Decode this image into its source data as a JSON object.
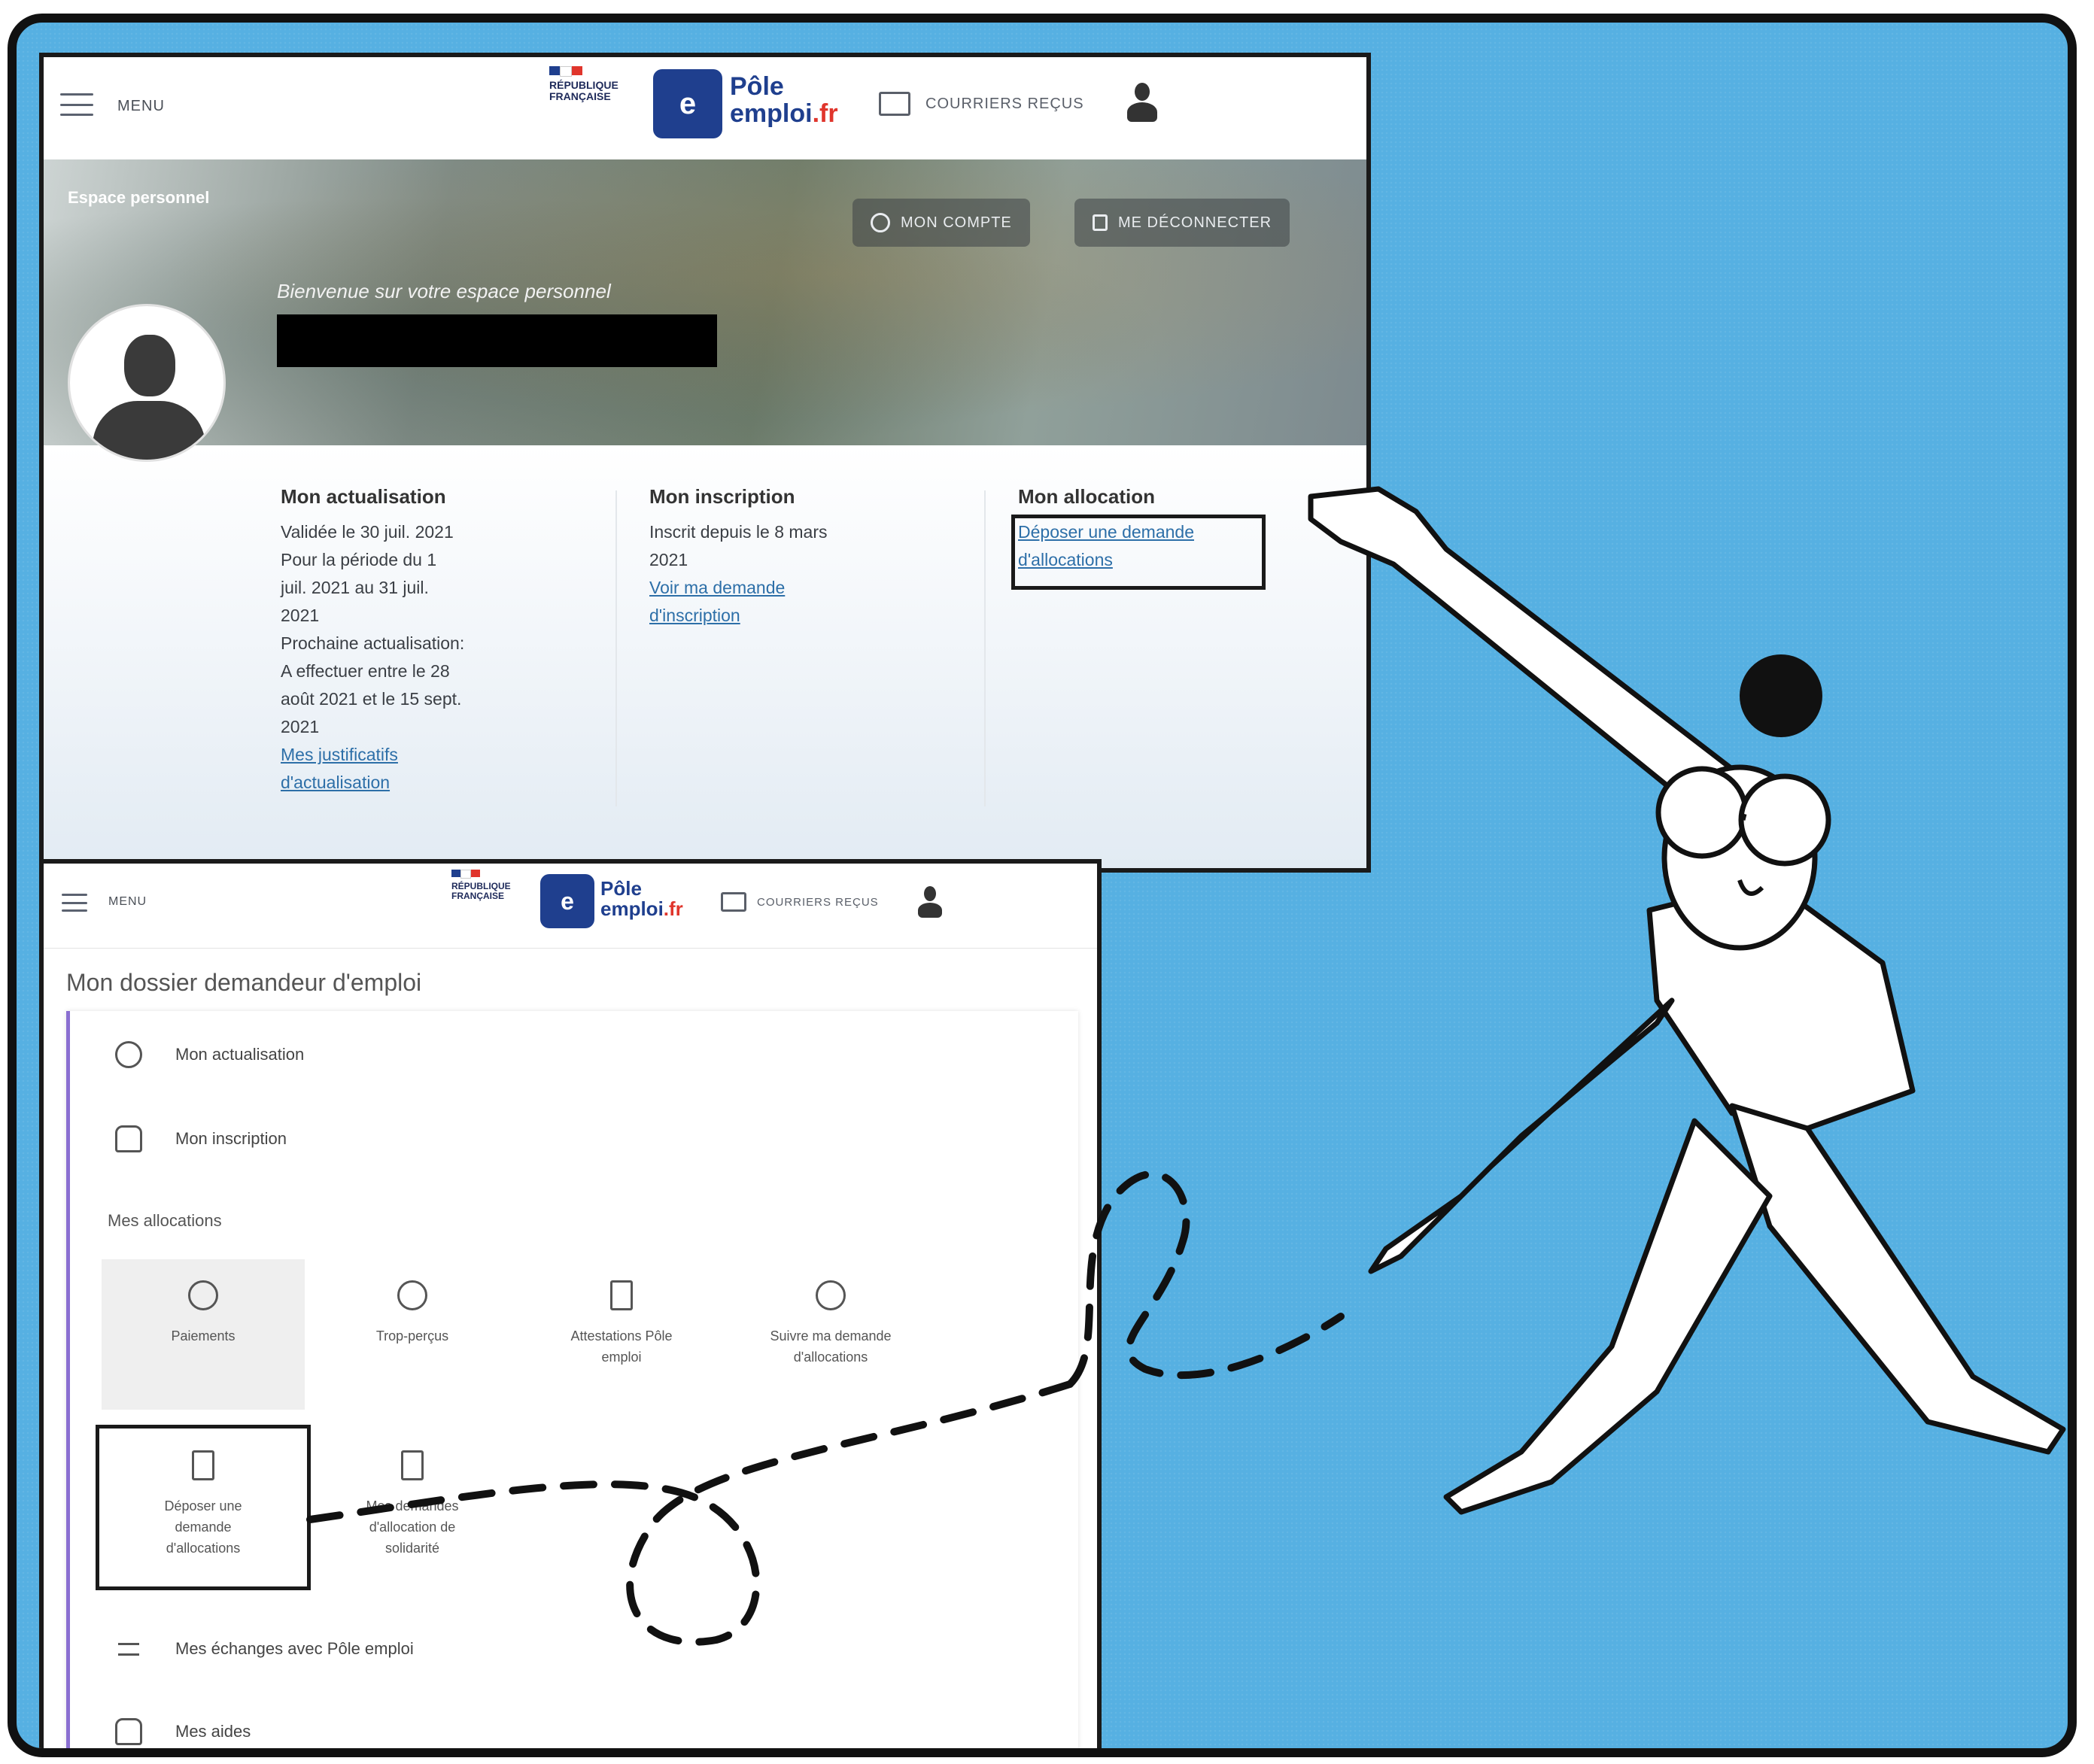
{
  "screen1": {
    "header": {
      "menu_label": "MENU",
      "rf_lines": [
        "RÉPUBLIQUE",
        "FRANÇAISE"
      ],
      "logo_text_line1": "Pôle",
      "logo_text_line2": "emploi",
      "logo_text_suffix": ".fr",
      "mail_label": "COURRIERS REÇUS"
    },
    "banner": {
      "breadcrumb": "Espace personnel",
      "account_button": "MON COMPTE",
      "logout_button": "ME DÉCONNECTER",
      "welcome": "Bienvenue sur votre espace personnel"
    },
    "columns": {
      "actualisation": {
        "title": "Mon actualisation",
        "lines": [
          "Validée le 30 juil. 2021",
          "Pour la période du 1",
          "juil. 2021 au 31 juil.",
          "2021",
          "Prochaine actualisation:",
          "A effectuer entre le 28",
          "août 2021 et le 15 sept.",
          "2021"
        ],
        "link_line1": "Mes justificatifs",
        "link_line2": "d'actualisation"
      },
      "inscription": {
        "title": "Mon inscription",
        "lines": [
          "Inscrit depuis le 8 mars",
          "2021"
        ],
        "link_line1": "Voir ma demande",
        "link_line2": "d'inscription"
      },
      "allocation": {
        "title": "Mon allocation",
        "link_line1": "Déposer une demande",
        "link_line2": "d'allocations"
      }
    }
  },
  "screen2": {
    "header": {
      "menu_label": "MENU",
      "rf_lines": [
        "RÉPUBLIQUE",
        "FRANÇAISE"
      ],
      "logo_text_line1": "Pôle",
      "logo_text_line2": "emploi",
      "logo_text_suffix": ".fr",
      "mail_label": "COURRIERS REÇUS"
    },
    "title": "Mon dossier demandeur d'emploi",
    "rows": {
      "actualisation": "Mon actualisation",
      "inscription": "Mon inscription",
      "echanges": "Mes échanges avec Pôle emploi",
      "aides": "Mes aides"
    },
    "section_label": "Mes allocations",
    "tiles": {
      "paiements": [
        "Paiements"
      ],
      "trop_percus": [
        "Trop-perçus"
      ],
      "attestations": [
        "Attestations Pôle",
        "emploi"
      ],
      "suivre": [
        "Suivre ma demande",
        "d'allocations"
      ],
      "deposer": [
        "Déposer une",
        "demande",
        "d'allocations"
      ],
      "solidarite": [
        "Mes demandes",
        "d'allocation de",
        "solidarité"
      ]
    }
  },
  "colors": {
    "background": "#56b0e2",
    "brand_blue": "#1f3f8e",
    "link": "#2d6fa8",
    "accent_purple": "#8a6fd1"
  }
}
